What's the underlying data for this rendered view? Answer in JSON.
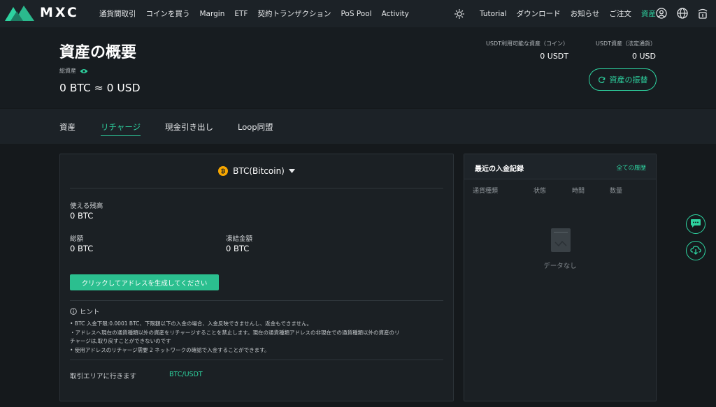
{
  "nav": {
    "brand": "MXC",
    "left_items": [
      "通貨間取引",
      "コインを買う",
      "Margin",
      "ETF",
      "契約トランザクション",
      "PoS Pool",
      "Activity"
    ],
    "right_items": [
      "Tutorial",
      "ダウンロード",
      "お知らせ",
      "ご注文",
      "資産"
    ],
    "active_item": "資産",
    "icons": [
      "sun-icon",
      "user-icon",
      "globe-icon",
      "download-app-icon"
    ]
  },
  "header": {
    "title": "資産の概要",
    "total_label": "総資産",
    "total_value": "0 BTC ≈ 0 USD",
    "coin_asset_label": "USDT利用可能な資産（コイン）",
    "coin_asset_value": "0 USDT",
    "fiat_asset_label": "USDT資産（法定通貨）",
    "fiat_asset_value": "0 USD",
    "transfer_button": "資産の振替"
  },
  "tabs": [
    "資産",
    "リチャージ",
    "現金引き出し",
    "Loop同盟"
  ],
  "active_tab": "リチャージ",
  "deposit": {
    "coin_symbol": "₿",
    "coin": "BTC(Bitcoin)",
    "available_label": "使える残高",
    "available_value": "0 BTC",
    "total_label": "総額",
    "total_value": "0 BTC",
    "frozen_label": "凍結金額",
    "frozen_value": "0 BTC",
    "generate_button": "クリックしてアドレスを生成してください",
    "hint_title": "ヒント",
    "hints": [
      "• BTC 入金下限:0.0001 BTC、下限額以下の入金の場合、入金反映できませんし、返金もできません。",
      "・アドレスへ現在の通貨種類以外の資産をリチャージすることを禁止します。現在の通貨種類アドレスの非現在での通貨種類以外の資産のリ",
      "チャージは,取り戻すことができないのです",
      "• 使用アドレスのリチャージ需要 2 ネットワークの確認で入金することができます。"
    ],
    "trade_label": "取引エリアに行きます",
    "trade_link": "BTC/USDT"
  },
  "records": {
    "title": "最近の入金記録",
    "all_link": "全ての履歴",
    "columns": [
      "通貨種類",
      "状態",
      "時間",
      "数量"
    ],
    "empty_text": "データなし"
  },
  "float_buttons": [
    "chat-icon",
    "cloud-download-icon"
  ],
  "colors": {
    "accent": "#2ed3a0",
    "background": "#15191c",
    "panel": "#1b2024",
    "btc": "#f7a600"
  }
}
